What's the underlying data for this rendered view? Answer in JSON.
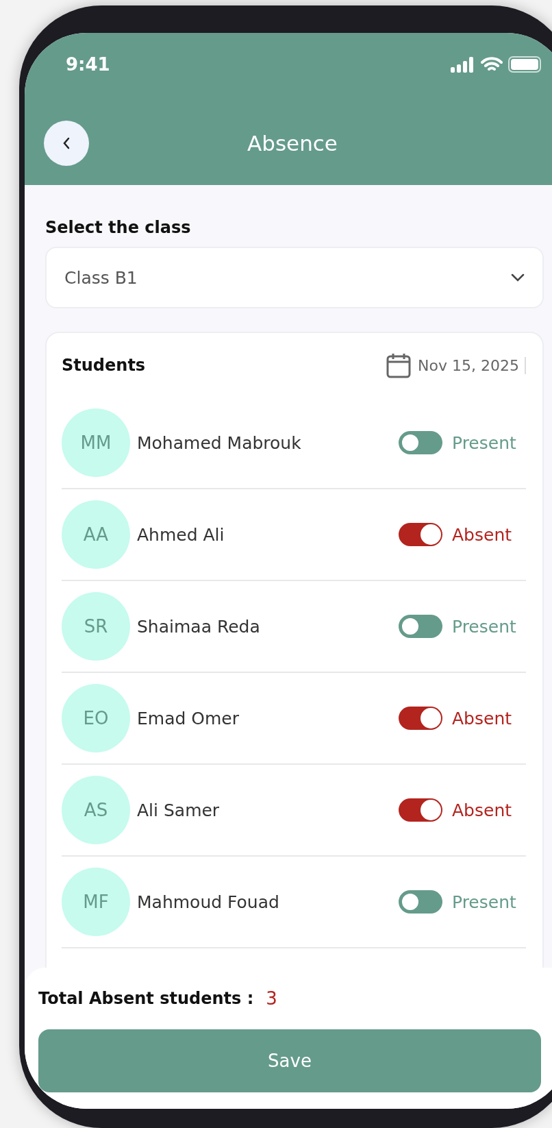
{
  "status_bar": {
    "time": "9:41"
  },
  "header": {
    "title": "Absence"
  },
  "class_select": {
    "label": "Select the class",
    "value": "Class B1"
  },
  "students": {
    "title": "Students",
    "date": "Nov 15, 2025",
    "rows": [
      {
        "initials": "MM",
        "name": "Mohamed Mabrouk",
        "absent": false,
        "status": "Present"
      },
      {
        "initials": "AA",
        "name": "Ahmed Ali",
        "absent": true,
        "status": "Absent"
      },
      {
        "initials": "SR",
        "name": "Shaimaa Reda",
        "absent": false,
        "status": "Present"
      },
      {
        "initials": "EO",
        "name": "Emad Omer",
        "absent": true,
        "status": "Absent"
      },
      {
        "initials": "AS",
        "name": "Ali Samer",
        "absent": true,
        "status": "Absent"
      },
      {
        "initials": "MF",
        "name": "Mahmoud Fouad",
        "absent": false,
        "status": "Present"
      }
    ]
  },
  "footer": {
    "total_label": "Total Absent students :",
    "total_value": "3",
    "save": "Save"
  }
}
